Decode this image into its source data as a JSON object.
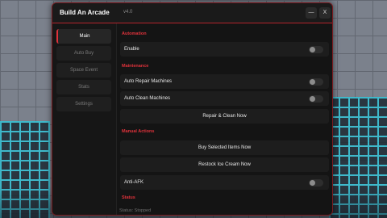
{
  "window": {
    "title": "Build An Arcade",
    "version": "v4.0",
    "minimize_label": "—",
    "close_label": "X"
  },
  "sidebar": {
    "items": [
      {
        "label": "Main",
        "active": true
      },
      {
        "label": "Auto Buy",
        "active": false
      },
      {
        "label": "Space Event",
        "active": false
      },
      {
        "label": "Stats",
        "active": false
      },
      {
        "label": "Settings",
        "active": false
      }
    ]
  },
  "main": {
    "automation": {
      "heading": "Automation",
      "enable_label": "Enable",
      "enable_on": false
    },
    "maintenance": {
      "heading": "Maintenance",
      "auto_repair_label": "Auto Repair Machines",
      "auto_repair_on": false,
      "auto_clean_label": "Auto Clean Machines",
      "auto_clean_on": false,
      "repair_clean_button": "Repair & Clean Now"
    },
    "manual": {
      "heading": "Manual Actions",
      "buy_selected_button": "Buy Selected Items Now",
      "restock_button": "Restock Ice Cream Now",
      "anti_afk_label": "Anti-AFK",
      "anti_afk_on": false
    },
    "status": {
      "heading": "Status",
      "text": "Status: Stopped"
    }
  },
  "colors": {
    "accent": "#e0323b",
    "window_bg": "#141414",
    "row_bg": "#1d1d1d"
  }
}
